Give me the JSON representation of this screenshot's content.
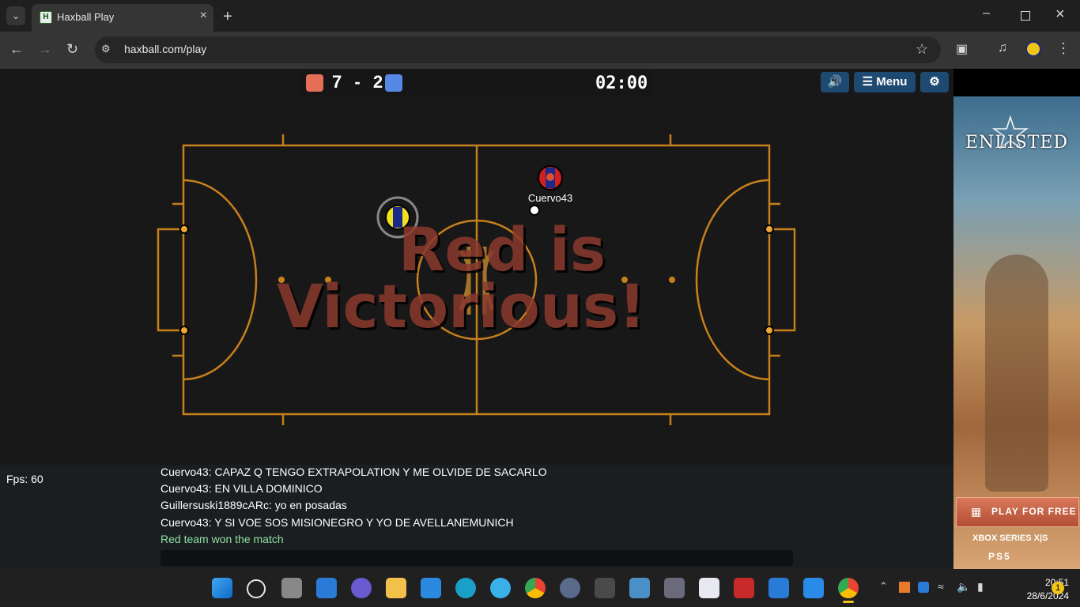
{
  "browser": {
    "tab_title": "Haxball Play",
    "favicon_letter": "H",
    "url": "haxball.com/play"
  },
  "game": {
    "score_red": "7",
    "score_sep": "-",
    "score_blue": "2",
    "timer": "02:00",
    "menu_label": "☰ Menu",
    "red_color": "#e56e56",
    "blue_color": "#5689e5",
    "line_color": "#c7801b",
    "banner_line1": "Red is",
    "banner_line2": "Victorious!",
    "player_name": "Cuervo43",
    "fps": "Fps: 60"
  },
  "chat": {
    "lines": [
      "Cuervo43: CAPAZ Q TENGO EXTRAPOLATION Y ME OLVIDE DE SACARLO",
      "Cuervo43: EN VILLA DOMINICO",
      "Guillersuski1889cARc: yo en posadas",
      "Cuervo43: Y SI VOE SOS MISIONEGRO Y YO DE AVELLANEMUNICH"
    ],
    "system_line": "Red team won the match"
  },
  "ad": {
    "logo": "ENLISTED",
    "cta": "PLAY FOR FREE",
    "xbox": "XBOX SERIES X|S",
    "ps": "PS5"
  },
  "taskbar": {
    "time": "20:51",
    "date": "28/6/2024",
    "notification_count": "1"
  }
}
